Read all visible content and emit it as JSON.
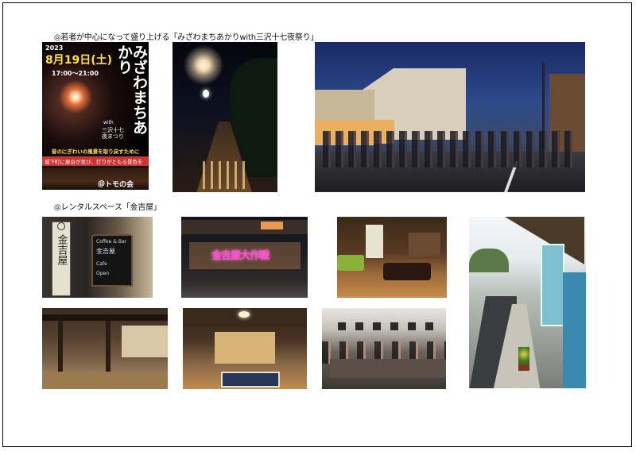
{
  "sections": {
    "festival": {
      "heading": "◎若者が中心になって盛り上げる「みざわまちあかりwith三沢十七夜祭り」"
    },
    "rental": {
      "heading": "◎レンタルスペース「金吉屋」"
    }
  },
  "poster": {
    "year": "2023",
    "date": "8月19日(土)",
    "time": "17:00～21:00",
    "title": "みざわまちあかり",
    "with": "with",
    "subtitle_line1": "三沢十七",
    "subtitle_line2": "夜まつり",
    "lead": "昔のにぎわいの風景を取り戻すために",
    "body": "城下町に屋台が並び、灯りがともる景色を",
    "organizer": "＠トモの会"
  },
  "kinkichiya": {
    "sign_text": "金吉屋",
    "chalk_line1": "Coffee & Bar",
    "chalk_line2": "金吉屋",
    "chalk_line3": "Cafe",
    "chalk_line4": "Open",
    "neon_text": "金吉屋大作戦"
  }
}
